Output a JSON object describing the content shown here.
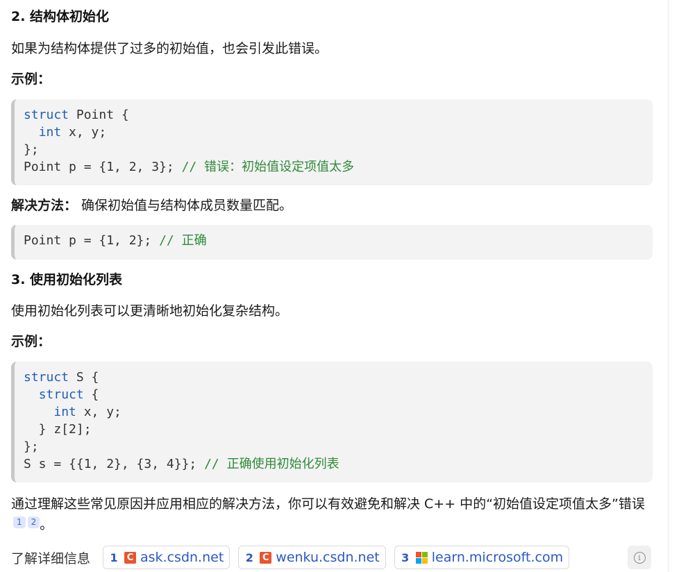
{
  "section2": {
    "heading": "2. 结构体初始化",
    "desc": "如果为结构体提供了过多的初始值，也会引发此错误。",
    "example_label": "示例：",
    "code1": {
      "l1_kw": "struct",
      "l1_rest": " Point {",
      "l2_indent": "  ",
      "l2_kw": "int",
      "l2_rest": " x, y;",
      "l3": "};",
      "l4_code": "Point p = {1, 2, 3}; ",
      "l4_slashes": "// ",
      "l4_comment": "错误：初始值设定项值太多"
    },
    "solution_label": "解决方法：",
    "solution_text": " 确保初始值与结构体成员数量匹配。",
    "code2": {
      "l1_code": "Point p = {1, 2}; ",
      "l1_slashes": "// ",
      "l1_comment": "正确"
    }
  },
  "section3": {
    "heading": "3. 使用初始化列表",
    "desc": "使用初始化列表可以更清晰地初始化复杂结构。",
    "example_label": "示例：",
    "code": {
      "l1_kw": "struct",
      "l1_rest": " S {",
      "l2_indent": "  ",
      "l2_kw": "struct",
      "l2_rest": " {",
      "l3_indent": "    ",
      "l3_kw": "int",
      "l3_rest": " x, y;",
      "l4": "  } z[2];",
      "l5": "};",
      "l6_code": "S s = {{1, 2}, {3, 4}}; ",
      "l6_slashes": "// ",
      "l6_comment": "正确使用初始化列表"
    }
  },
  "summary": {
    "text": "通过理解这些常见原因并应用相应的解决方法，你可以有效避免和解决 C++ 中的“初始值设定项值太多”错误",
    "cite1": "1",
    "cite2": "2",
    "end": "。"
  },
  "references": {
    "label": "了解详细信息",
    "items": [
      {
        "num": "1",
        "icon": "csdn-icon",
        "icon_glyph": "C",
        "site": "ask.csdn.net"
      },
      {
        "num": "2",
        "icon": "csdn-icon",
        "icon_glyph": "C",
        "site": "wenku.csdn.net"
      },
      {
        "num": "3",
        "icon": "microsoft-icon",
        "site": "learn.microsoft.com"
      }
    ],
    "info_glyph": "i"
  },
  "colors": {
    "keyword": "#1f5fb4",
    "comment": "#2f8a3a",
    "link": "#2b58c4",
    "code_bg": "#f3f3f3"
  }
}
